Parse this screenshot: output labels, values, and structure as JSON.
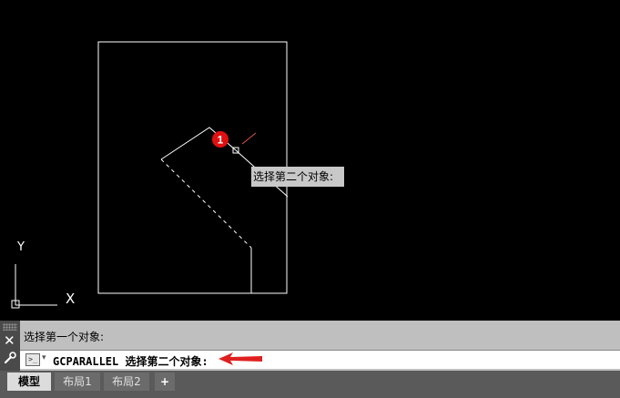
{
  "tooltip": {
    "text": "选择第二个对象:"
  },
  "marker": {
    "number": "1",
    "color": "#e01010"
  },
  "ucs": {
    "y_label": "Y",
    "x_glyph": "X"
  },
  "command_line": {
    "history": "选择第一个对象:",
    "current": "GCPARALLEL 选择第二个对象:",
    "prompt_icon": ">_",
    "close_glyph": "✕"
  },
  "tabs": [
    {
      "label": "模型",
      "active": true
    },
    {
      "label": "布局1",
      "active": false
    },
    {
      "label": "布局2",
      "active": false
    },
    {
      "label": "+",
      "active": false
    }
  ],
  "colors": {
    "background": "#000000",
    "geometry": "#ffffff",
    "annotation": "#e02020",
    "command_bar": "#bfbfbf"
  }
}
